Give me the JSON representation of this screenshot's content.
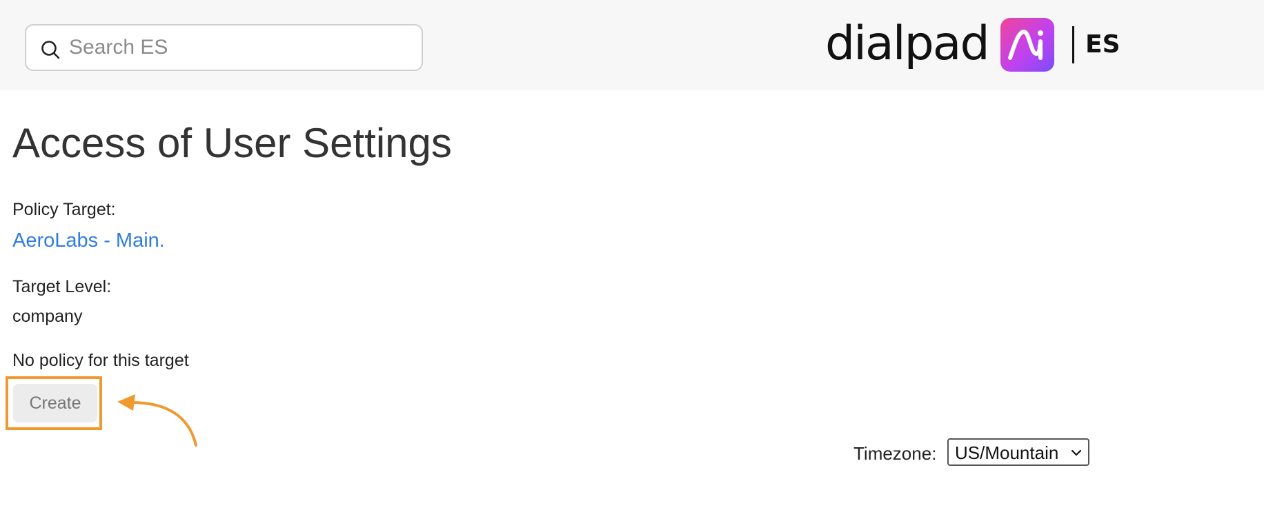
{
  "header": {
    "search": {
      "placeholder": "Search ES",
      "value": "",
      "icon": "search-icon"
    },
    "brand": {
      "wordmark": "dialpad",
      "badge_letters": "Ai",
      "badge_colors": [
        "#f0459a",
        "#c042f0",
        "#7a4df6"
      ],
      "suffix": "ES"
    }
  },
  "main": {
    "title": "Access of User Settings",
    "policy_target": {
      "label": "Policy Target:",
      "link_text": "AeroLabs - Main.",
      "link_color": "#2f7de1"
    },
    "target_level": {
      "label": "Target Level:",
      "value": "company"
    },
    "no_policy_note": "No policy for this target",
    "create_button_label": "Create",
    "annotation_color": "#f0992e"
  },
  "footer": {
    "timezone": {
      "label": "Timezone:",
      "selected": "US/Mountain",
      "icon": "chevron-down-icon"
    }
  }
}
